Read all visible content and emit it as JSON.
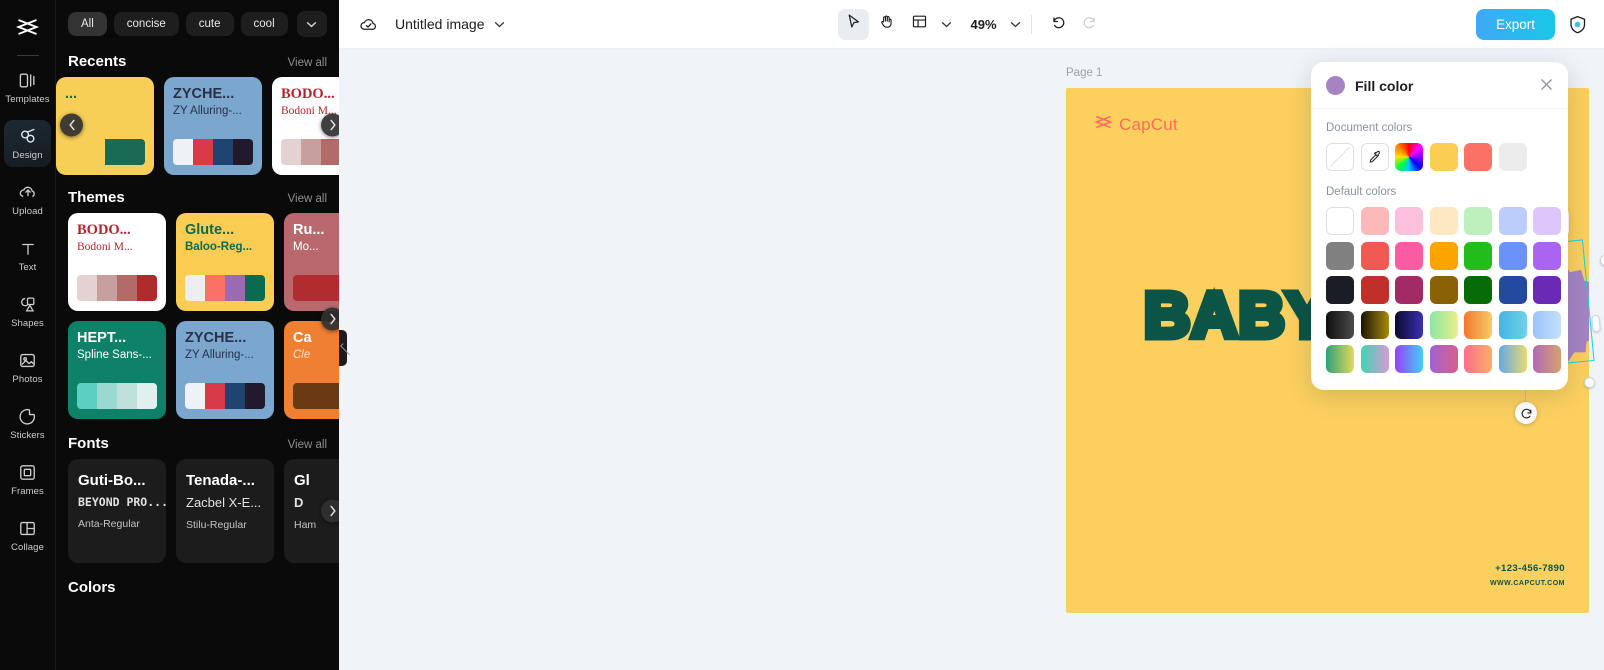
{
  "rail": {
    "logo_icon": "capcut-logo-icon",
    "items": [
      {
        "label": "Templates",
        "icon": "templates-icon",
        "active": false
      },
      {
        "label": "Design",
        "icon": "design-icon",
        "active": true
      },
      {
        "label": "Upload",
        "icon": "upload-icon",
        "active": false
      },
      {
        "label": "Text",
        "icon": "text-icon",
        "active": false
      },
      {
        "label": "Shapes",
        "icon": "shapes-icon",
        "active": false
      },
      {
        "label": "Photos",
        "icon": "photos-icon",
        "active": false
      },
      {
        "label": "Stickers",
        "icon": "stickers-icon",
        "active": false
      },
      {
        "label": "Frames",
        "icon": "frames-icon",
        "active": false
      },
      {
        "label": "Collage",
        "icon": "collage-icon",
        "active": false
      }
    ]
  },
  "panel": {
    "chips": [
      {
        "label": "All",
        "active": true
      },
      {
        "label": "concise",
        "active": false
      },
      {
        "label": "cute",
        "active": false
      },
      {
        "label": "cool",
        "active": false
      }
    ],
    "chip_more_icon": "chevron-down-icon",
    "sections": {
      "recents": {
        "title": "Recents",
        "view_all": "View all",
        "cards": [
          {
            "t1": "...",
            "t2": "",
            "bg": "#f7cf57",
            "c1": "#1b6a53",
            "c2": "#1b6a53",
            "swatches": [
              "#f7cf57",
              "#f7cf57",
              "#1b6a53",
              "#1b6a53"
            ]
          },
          {
            "t1": "ZYCHE...",
            "t2": "ZY Alluring-...",
            "bg": "#7ba7cf",
            "c1": "#28304a",
            "c2": "#28304a",
            "swatches": [
              "#eef1f6",
              "#d93a4a",
              "#1e4470",
              "#221a2c"
            ]
          },
          {
            "t1": "BODO...",
            "t2": "Bodoni M...",
            "bg": "#ffffff",
            "c1": "#b5212c",
            "c2": "#b5212c",
            "swatches": [
              "#e3d2d1",
              "#c79f9d",
              "#b36b68",
              "#ae2c2e"
            ]
          }
        ]
      },
      "themes": {
        "title": "Themes",
        "view_all": "View all",
        "cards": [
          {
            "t1": "BODO...",
            "t2": "Bodoni M...",
            "bg": "#ffffff",
            "c1": "#b5212c",
            "c2": "#b5212c",
            "swatches": [
              "#e3d2d1",
              "#c79f9d",
              "#b36b68",
              "#ae2c2e"
            ]
          },
          {
            "t1": "Glute...",
            "t2": "Baloo-Reg...",
            "bg": "#fbce53",
            "c1": "#0b6b50",
            "c2": "#0b6b50",
            "swatches": [
              "#eeeef0",
              "#fb7166",
              "#9a6ab3",
              "#0b6b50"
            ]
          },
          {
            "t1": "Ru...",
            "t2": "Mo...",
            "bg": "#b9696e",
            "c1": "#ffffff",
            "c2": "#ffffff",
            "swatches": [
              "#b02c2f",
              "#b02c2f",
              "#b02c2f",
              "#b02c2f"
            ]
          },
          {
            "t1": "HEPT...",
            "t2": "Spline Sans-...",
            "bg": "#0f8168",
            "c1": "#ffffff",
            "c2": "#ffffff",
            "swatches": [
              "#5ccfc0",
              "#9bd8cf",
              "#bfe0da",
              "#dff0ee"
            ]
          },
          {
            "t1": "ZYCHE...",
            "t2": "ZY Alluring-...",
            "bg": "#7ba7cf",
            "c1": "#28304a",
            "c2": "#28304a",
            "swatches": [
              "#eef1f6",
              "#d93a4a",
              "#1e4470",
              "#221a2c"
            ]
          },
          {
            "t1": "Ca",
            "t2": "Cle",
            "bg": "#ef7f33",
            "c1": "#ffffff",
            "c2": "#f7e0c5",
            "swatches": [
              "#6b3a13",
              "#6b3a13",
              "#6b3a13",
              "#6b3a13"
            ]
          }
        ]
      },
      "fonts": {
        "title": "Fonts",
        "view_all": "View all",
        "cards": [
          {
            "f1": "Guti-Bo...",
            "f2": "BEYOND PRO...",
            "f3": "Anta-Regular"
          },
          {
            "f1": "Tenada-...",
            "f2": "Zacbel X-E...",
            "f3": "Stilu-Regular"
          },
          {
            "f1": "Gl",
            "f2": "D",
            "f3": "Ham"
          }
        ]
      },
      "colors": {
        "title": "Colors"
      }
    },
    "nav_prev_icon": "chevron-left-icon",
    "nav_next_icon": "chevron-right-icon",
    "collapse_handle_icon": "panel-collapse-icon"
  },
  "topbar": {
    "cloud_icon": "cloud-saved-icon",
    "doc_title": "Untitled image",
    "title_chevron_icon": "chevron-down-icon",
    "tools": [
      {
        "name": "select-tool",
        "icon": "cursor-arrow-icon",
        "selected": true
      },
      {
        "name": "hand-tool",
        "icon": "hand-icon",
        "selected": false
      },
      {
        "name": "layout-tool",
        "icon": "layout-icon",
        "selected": false
      }
    ],
    "layout_chevron_icon": "chevron-down-icon",
    "zoom_value": "49%",
    "zoom_chevron_icon": "chevron-down-icon",
    "undo_icon": "undo-icon",
    "redo_icon": "redo-icon",
    "export_label": "Export",
    "shield_icon": "shield-icon"
  },
  "canvas": {
    "page_label": "Page 1",
    "background_color": "#fcd05f",
    "brand_name": "CapCut",
    "brand_color": "#fc6c5c",
    "brand_logo_icon": "capcut-logo-icon",
    "menu_icon": "hamburger-menu-icon",
    "headline": "BABYTOY",
    "headline_color": "#0c5446",
    "shape_color": "#a684c4",
    "phone": "+123-456-7890",
    "website": "WWW.CAPCUT.COM",
    "float_toolbar": [
      {
        "name": "duplicate-button",
        "icon": "duplicate-icon"
      },
      {
        "name": "more-options-button",
        "icon": "ellipsis-icon"
      }
    ],
    "rotate_icon": "rotate-icon",
    "selection_color": "#0ed6e0"
  },
  "fill_panel": {
    "title": "Fill color",
    "current_color": "#a684c4",
    "close_icon": "close-icon",
    "document_colors_label": "Document colors",
    "document_colors": [
      {
        "name": "transparent-swatch",
        "type": "none"
      },
      {
        "name": "eyedropper-swatch",
        "type": "eyedropper"
      },
      {
        "name": "color-wheel-swatch",
        "type": "wheel"
      },
      {
        "name": "yellow-swatch",
        "type": "solid",
        "color": "#fbce53"
      },
      {
        "name": "coral-swatch",
        "type": "solid",
        "color": "#fb7166"
      },
      {
        "name": "light-gray-swatch",
        "type": "solid",
        "color": "#ececec"
      }
    ],
    "default_colors_label": "Default colors",
    "default_colors": [
      [
        "#ffffff",
        "#fcb9b9",
        "#fcc0dd",
        "#fce9c2",
        "#bdf0bd",
        "#bcccfb",
        "#ddc6fa"
      ],
      [
        "#808080",
        "#ef5b52",
        "#fb5ba2",
        "#fca400",
        "#22bd1c",
        "#6b92fb",
        "#a964f2"
      ],
      [
        "#1a1d23",
        "#c0302b",
        "#a32b65",
        "#8a6104",
        "#076b07",
        "#234a9e",
        "#6b2ab5"
      ],
      [
        "linear-gradient(90deg,#0f0f0f,#4b4b4b)",
        "linear-gradient(90deg,#1b1405,#a98a0d)",
        "linear-gradient(90deg,#0c0c2e,#3a2fb5)",
        "linear-gradient(90deg,#8ae6a2,#e9f08a)",
        "linear-gradient(90deg,#f4772e,#f7cd68)",
        "linear-gradient(90deg,#43b5e5,#6fd1e6)",
        "linear-gradient(90deg,#9bc4f8,#c3e0fb)"
      ],
      [
        "linear-gradient(90deg,#2ea277,#e3d85c)",
        "linear-gradient(90deg,#3fd4b0,#d79ad6)",
        "linear-gradient(90deg,#9b3ef7,#3fd1f7)",
        "linear-gradient(90deg,#a262d0,#d6608d)",
        "linear-gradient(90deg,#fb6e8c,#fcae68)",
        "linear-gradient(90deg,#63a8e8,#e7dc70)",
        "linear-gradient(90deg,#b06bb5,#d7a06f)"
      ]
    ]
  }
}
